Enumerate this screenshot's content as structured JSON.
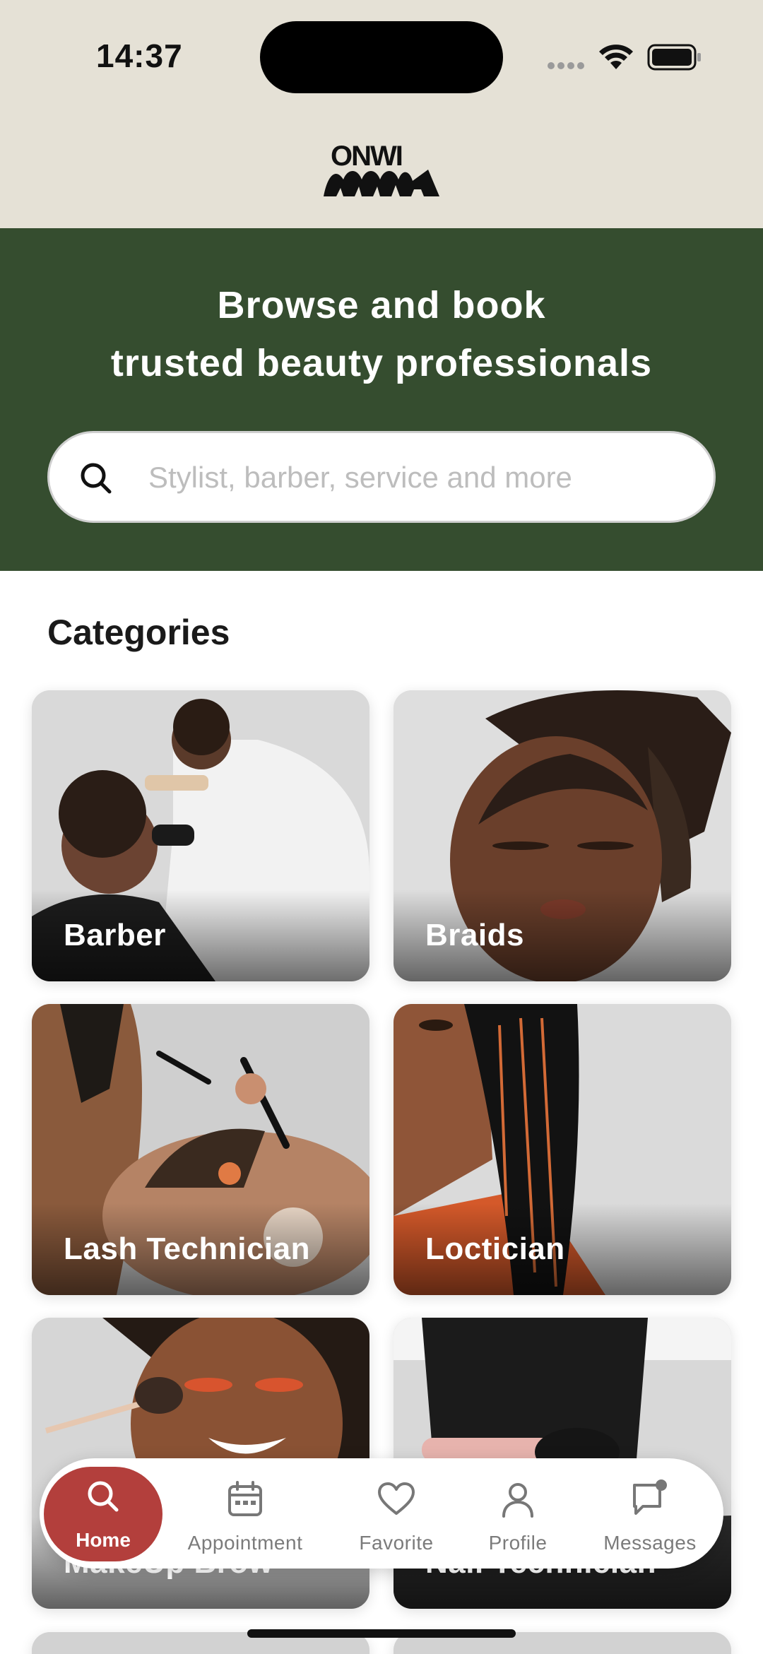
{
  "status_bar": {
    "time": "14:37"
  },
  "brand": {
    "logo_text_line1": "ONWI",
    "logo_text_line2": "MMA"
  },
  "hero": {
    "title_line1": "Browse and book",
    "title_line2": "trusted beauty professionals",
    "background_color": "#354d2f"
  },
  "search": {
    "placeholder": "Stylist, barber, service and more",
    "value": ""
  },
  "categories": {
    "heading": "Categories",
    "items": [
      {
        "label": "Barber"
      },
      {
        "label": "Braids"
      },
      {
        "label": "Lash Technician"
      },
      {
        "label": "Loctician"
      },
      {
        "label": "MakeUp Brow"
      },
      {
        "label": "Nail Technician"
      }
    ]
  },
  "nav": {
    "active_color": "#b33f3c",
    "items": [
      {
        "label": "Home",
        "icon": "search-icon",
        "active": true
      },
      {
        "label": "Appointment",
        "icon": "calendar-icon"
      },
      {
        "label": "Favorite",
        "icon": "heart-icon"
      },
      {
        "label": "Profile",
        "icon": "person-icon"
      },
      {
        "label": "Messages",
        "icon": "chat-icon",
        "badge": true
      }
    ]
  }
}
